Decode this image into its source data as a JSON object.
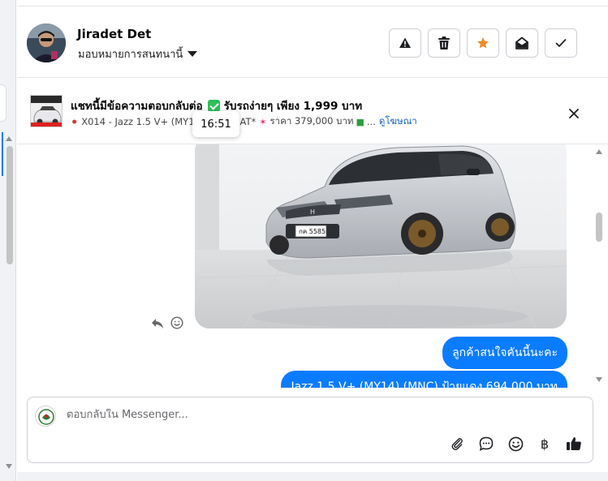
{
  "header": {
    "contact_name": "Jiradet Det",
    "assign_label": "มอบหมายการสนทนานี้",
    "actions": [
      {
        "name": "report-button",
        "icon": "warning-icon"
      },
      {
        "name": "delete-button",
        "icon": "trash-icon"
      },
      {
        "name": "star-button",
        "icon": "star-icon"
      },
      {
        "name": "mark-unread-button",
        "icon": "envelope-open-icon"
      },
      {
        "name": "mark-done-button",
        "icon": "check-icon"
      }
    ]
  },
  "banner": {
    "title_prefix": "แชทนี้มีข้อความตอบกลับต่อ",
    "title_suffix": "รับรถง่ายๆ เพียง 1,999 บาท",
    "sub_model": "X014 - Jazz 1.5 V+ (MY1",
    "sub_hidden": "AT*",
    "sub_price": "ราคา 379,000 บาท",
    "sub_more": "...",
    "link_label": "ดูโฆษณา"
  },
  "tooltip": {
    "time": "16:51"
  },
  "messages": [
    {
      "type": "image",
      "subject": "car-photo",
      "plate": "กค 5585"
    },
    {
      "type": "text",
      "direction": "outgoing",
      "text": "ลูกค้าสนใจคันนี้นะคะ"
    },
    {
      "type": "text",
      "direction": "outgoing",
      "text": "Jazz 1.5 V+ (MY14) (MNC) ป้ายแดง 694,000 บาท"
    }
  ],
  "composer": {
    "placeholder": "ตอบกลับใน Messenger...",
    "baht_symbol": "฿",
    "tools": [
      "attach-icon",
      "saved-reply-icon",
      "emoji-icon",
      "payment-icon",
      "like-icon"
    ]
  },
  "colors": {
    "accent": "#0a7cff",
    "star": "#f08a24",
    "link": "#1461c9"
  }
}
